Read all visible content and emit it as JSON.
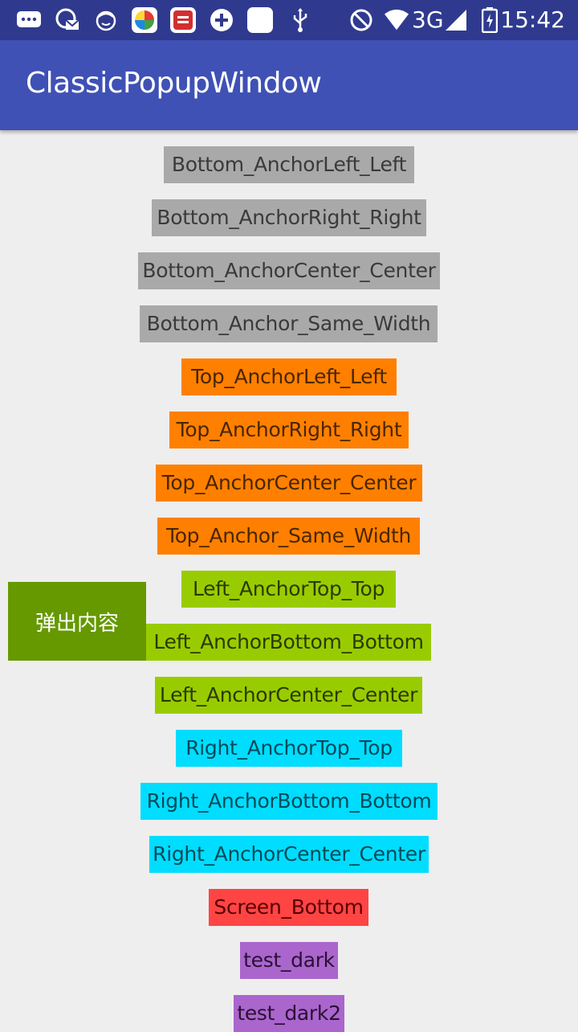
{
  "status_bar": {
    "time": "15:42",
    "network": "3G",
    "icons": [
      "chat-icon",
      "mail-sync-icon",
      "face-icon",
      "app-store-icon",
      "news-app-icon",
      "plus-circle-icon",
      "blank-app-icon",
      "usb-icon",
      "do-not-disturb-icon",
      "wifi-icon",
      "signal-icon",
      "battery-charging-icon"
    ]
  },
  "toolbar": {
    "title": "ClassicPopupWindow"
  },
  "buttons": [
    {
      "label": "Bottom_AnchorLeft_Left",
      "color": "#a9a9a9"
    },
    {
      "label": "Bottom_AnchorRight_Right",
      "color": "#a9a9a9"
    },
    {
      "label": "Bottom_AnchorCenter_Center",
      "color": "#a9a9a9"
    },
    {
      "label": "Bottom_Anchor_Same_Width",
      "color": "#a9a9a9"
    },
    {
      "label": "Top_AnchorLeft_Left",
      "color": "#ff8000"
    },
    {
      "label": "Top_AnchorRight_Right",
      "color": "#ff8000"
    },
    {
      "label": "Top_AnchorCenter_Center",
      "color": "#ff8000"
    },
    {
      "label": "Top_Anchor_Same_Width",
      "color": "#ff8000"
    },
    {
      "label": "Left_AnchorTop_Top",
      "color": "#99cc00"
    },
    {
      "label": "Left_AnchorBottom_Bottom",
      "color": "#99cc00"
    },
    {
      "label": "Left_AnchorCenter_Center",
      "color": "#99cc00"
    },
    {
      "label": "Right_AnchorTop_Top",
      "color": "#00ddff"
    },
    {
      "label": "Right_AnchorBottom_Bottom",
      "color": "#00ddff"
    },
    {
      "label": "Right_AnchorCenter_Center",
      "color": "#00ddff"
    },
    {
      "label": "Screen_Bottom",
      "color": "#ff4444"
    },
    {
      "label": "test_dark",
      "color": "#aa66cc"
    },
    {
      "label": "test_dark2",
      "color": "#aa66cc"
    }
  ],
  "popup": {
    "label": "弹出内容",
    "color": "#669900"
  }
}
